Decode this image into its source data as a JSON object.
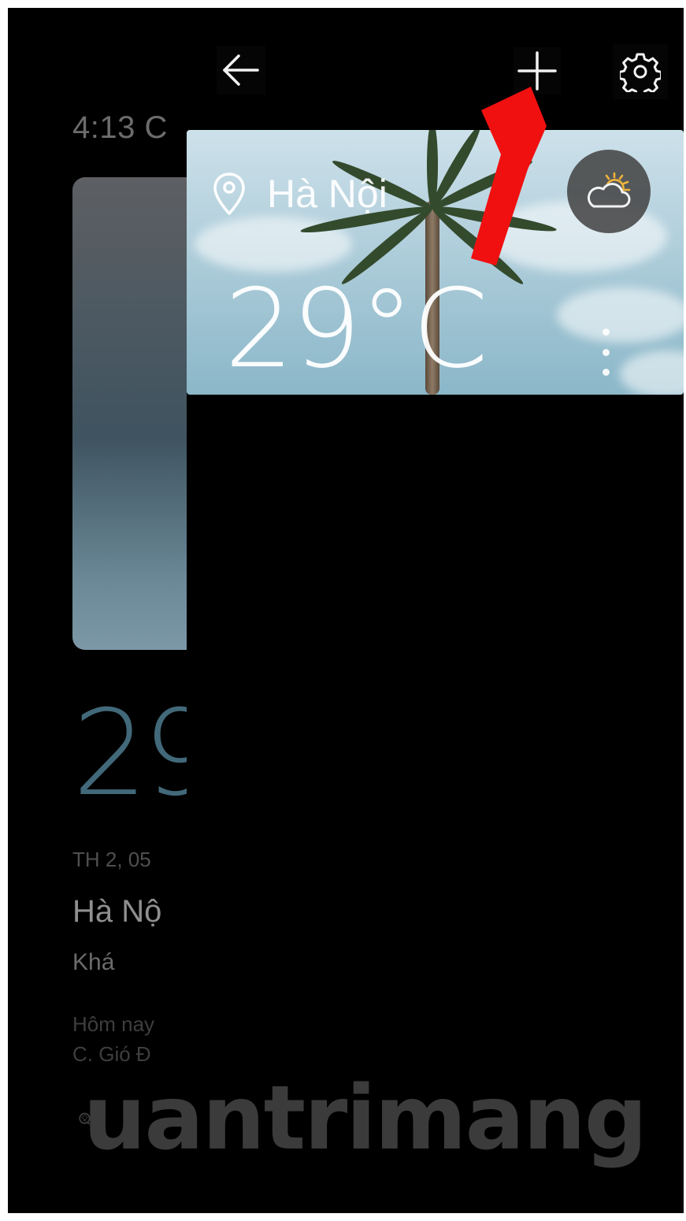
{
  "background_page": {
    "time": "4:13 C",
    "temperature": "29",
    "date": "TH 2, 05",
    "city": "Hà Nộ",
    "condition": "Khá",
    "desc_line1": "Hôm nay",
    "desc_line2": "C. Gió Đ"
  },
  "toolbar": {
    "back_icon": "arrow-left-icon",
    "add_icon": "plus-icon",
    "settings_icon": "gear-icon"
  },
  "city_card": {
    "location": "Hà Nội",
    "temperature": "29°C",
    "location_icon": "location-pin-icon",
    "weather_icon": "partly-cloudy-icon",
    "more_icon": "more-vertical-icon"
  },
  "annotation": {
    "color": "#f01010"
  },
  "watermark": {
    "text": "uantrimang",
    "logo_icon": "lightbulb-q-logo"
  }
}
